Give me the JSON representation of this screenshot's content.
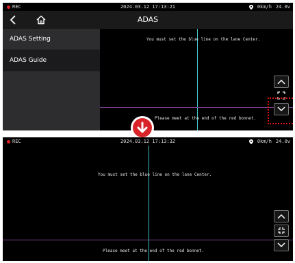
{
  "top_screen": {
    "status": {
      "rec": "REC",
      "datetime": "2024.03.12 17:13:21",
      "speed": "0km/h",
      "voltage": "24.0v"
    },
    "title": "ADAS",
    "menu": [
      {
        "label": "ADAS Setting"
      },
      {
        "label": "ADAS Guide"
      }
    ],
    "hint_top": "You must set the blue line on the lane Center.",
    "hint_bottom": "Please meet at the end of the red bonnet."
  },
  "bottom_screen": {
    "status": {
      "rec": "REC",
      "datetime": "2024.03.12 17:13:32",
      "speed": "0km/h",
      "voltage": "24.0v"
    },
    "hint_top": "You must set the blue line on the lane Center.",
    "hint_bottom": "Please meet at the end of the red bonnet."
  },
  "colors": {
    "lane_line": "#3fc6c8",
    "bonnet_line": "#7a3f90",
    "rec_dot": "#e02020",
    "highlight": "#d11111"
  },
  "icons": [
    "back-icon",
    "home-icon",
    "location-icon",
    "chevron-up-icon",
    "fullscreen-icon",
    "chevron-down-icon",
    "shrink-icon",
    "arrow-down-icon"
  ]
}
